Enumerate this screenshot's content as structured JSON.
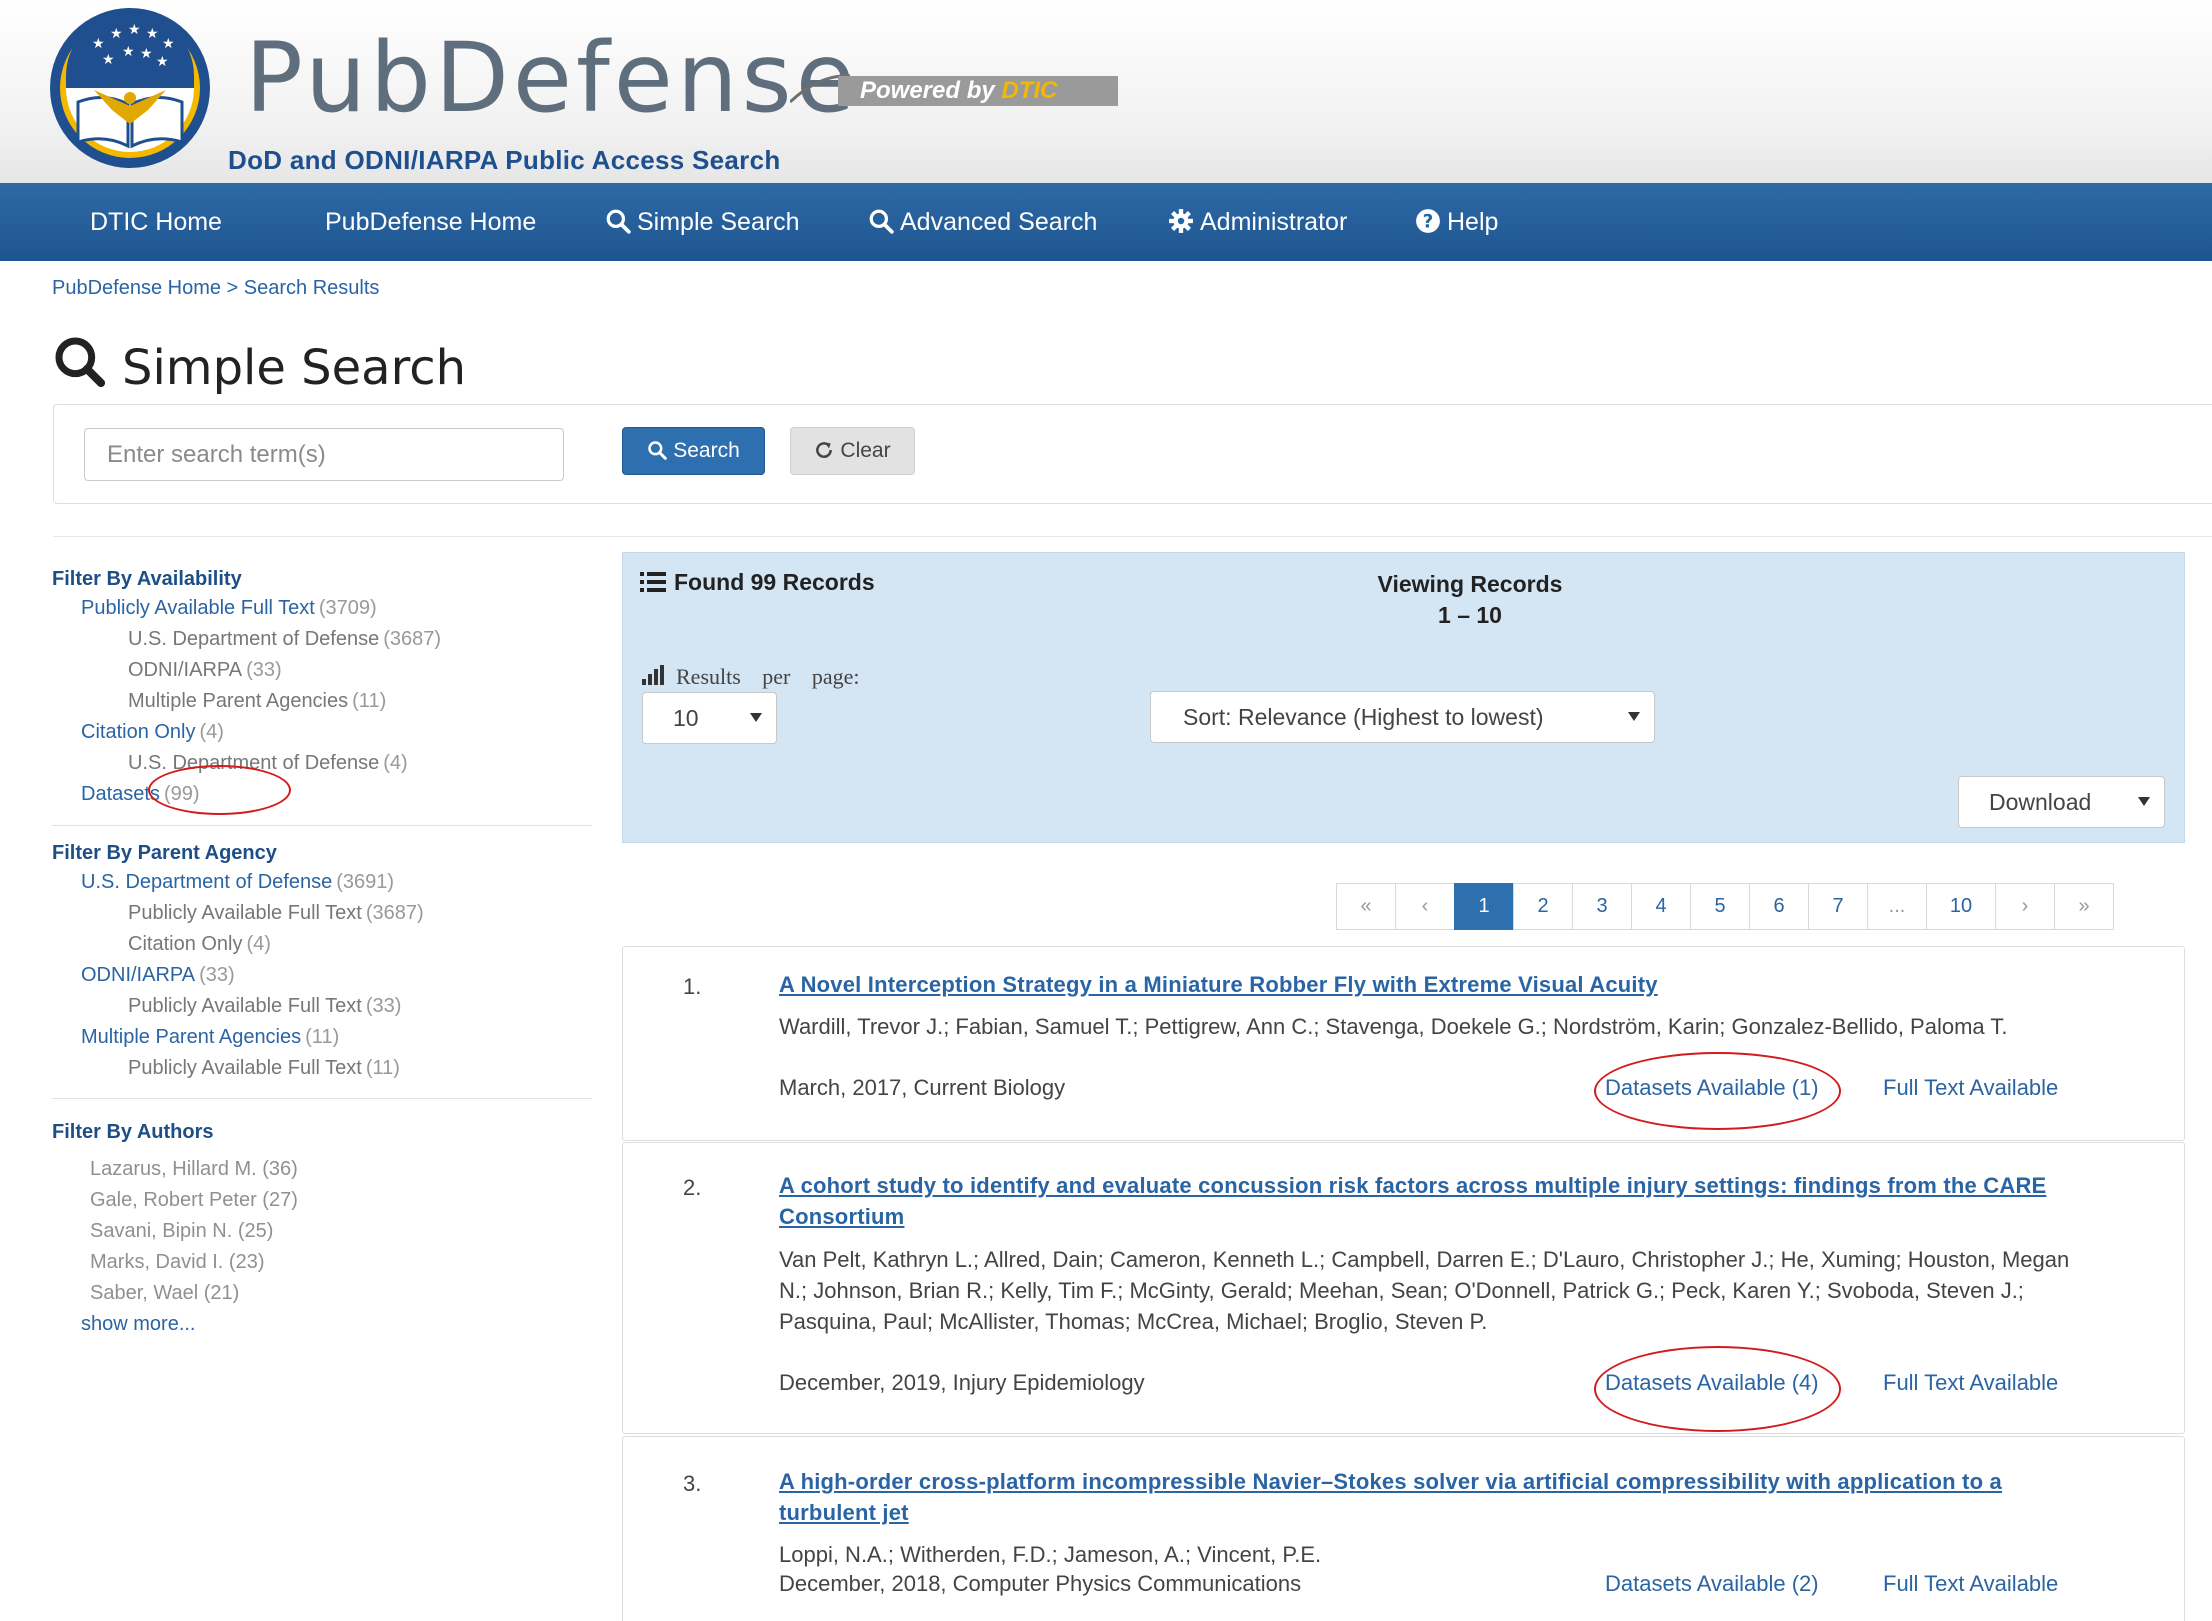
{
  "header": {
    "brand": "PubDefense",
    "powered_by": "Powered by ",
    "powered_by_brand": "DTIC",
    "tagline": "DoD and ODNI/IARPA Public Access Search"
  },
  "nav": [
    {
      "label": "DTIC Home",
      "icon": null
    },
    {
      "label": "PubDefense Home",
      "icon": null
    },
    {
      "label": "Simple Search",
      "icon": "search-icon"
    },
    {
      "label": "Advanced Search",
      "icon": "search-icon"
    },
    {
      "label": "Administrator",
      "icon": "gear-icon"
    },
    {
      "label": "Help",
      "icon": "question-circle-icon"
    }
  ],
  "breadcrumb": "PubDefense Home > Search Results",
  "page_title": "Simple Search",
  "search": {
    "placeholder": "Enter search term(s)",
    "value": "",
    "search_label": "Search",
    "clear_label": "Clear"
  },
  "filters": {
    "availability": {
      "heading": "Filter By Availability",
      "items": [
        {
          "label": "Publicly Available Full Text",
          "count": "(3709)"
        },
        {
          "label": "U.S. Department of Defense",
          "count": "(3687)"
        },
        {
          "label": "ODNI/IARPA",
          "count": "(33)"
        },
        {
          "label": "Multiple Parent Agencies",
          "count": "(11)"
        },
        {
          "label": "Citation Only",
          "count": "(4)"
        },
        {
          "label": "U.S. Department of Defense",
          "count": "(4)"
        },
        {
          "label": "Datasets",
          "count": "(99)"
        }
      ]
    },
    "parent_agency": {
      "heading": "Filter By Parent Agency",
      "items": [
        {
          "label": "U.S. Department of Defense",
          "count": "(3691)"
        },
        {
          "label": "Publicly Available Full Text",
          "count": "(3687)"
        },
        {
          "label": "Citation Only",
          "count": "(4)"
        },
        {
          "label": "ODNI/IARPA",
          "count": "(33)"
        },
        {
          "label": "Publicly Available Full Text",
          "count": "(33)"
        },
        {
          "label": "Multiple Parent Agencies",
          "count": "(11)"
        },
        {
          "label": "Publicly Available Full Text",
          "count": "(11)"
        }
      ]
    },
    "authors": {
      "heading": "Filter By Authors",
      "items": [
        "Lazarus, Hillard M. (36)",
        "Gale, Robert Peter (27)",
        "Savani, Bipin N. (25)",
        "Marks, David I. (23)",
        "Saber, Wael (21)"
      ],
      "show_more": "show more..."
    }
  },
  "results_header": {
    "found": "Found 99 Records",
    "viewing_label": "Viewing Records",
    "viewing_range": "1 – 10",
    "results_per_page_label": "Results per page:",
    "results_per_page_value": "10",
    "sort_value": "Sort: Relevance (Highest to lowest)",
    "download_label": "Download"
  },
  "pagination": [
    "«",
    "‹",
    "1",
    "2",
    "3",
    "4",
    "5",
    "6",
    "7",
    "...",
    "10",
    "›",
    "»"
  ],
  "pagination_active": "1",
  "results": [
    {
      "number": "1.",
      "title": "A Novel Interception Strategy in a Miniature Robber Fly with Extreme Visual Acuity",
      "authors": "Wardill, Trevor J.; Fabian, Samuel T.; Pettigrew, Ann C.; Stavenga, Doekele G.; Nordström, Karin; Gonzalez-Bellido, Paloma T.",
      "citation": "March, 2017, Current Biology",
      "datasets": "Datasets Available (1)",
      "fulltext": "Full Text Available"
    },
    {
      "number": "2.",
      "title": "A cohort study to identify and evaluate concussion risk factors across multiple injury settings: findings from the CARE Consortium",
      "authors": "Van Pelt, Kathryn L.; Allred, Dain; Cameron, Kenneth L.; Campbell, Darren E.; D'Lauro, Christopher J.; He, Xuming; Houston, Megan N.; Johnson, Brian R.; Kelly, Tim F.; McGinty, Gerald; Meehan, Sean; O'Donnell, Patrick G.; Peck, Karen Y.; Svoboda, Steven J.; Pasquina, Paul; McAllister, Thomas; McCrea, Michael; Broglio, Steven P.",
      "citation": "December, 2019, Injury Epidemiology",
      "datasets": "Datasets Available (4)",
      "fulltext": "Full Text Available"
    },
    {
      "number": "3.",
      "title": "A high-order cross-platform incompressible Navier–Stokes solver via artificial compressibility with application to a turbulent jet",
      "authors": "Loppi, N.A.; Witherden, F.D.; Jameson, A.; Vincent, P.E.",
      "citation": "December, 2018, Computer Physics Communications",
      "datasets": "Datasets Available (2)",
      "fulltext": "Full Text Available"
    }
  ],
  "colors": {
    "nav_bar": "#1d5590",
    "link": "#2a64a4",
    "results_header_bg": "#d4e5f3",
    "primary_button": "#2e6fb0",
    "annotation_oval": "#d21b1b"
  }
}
